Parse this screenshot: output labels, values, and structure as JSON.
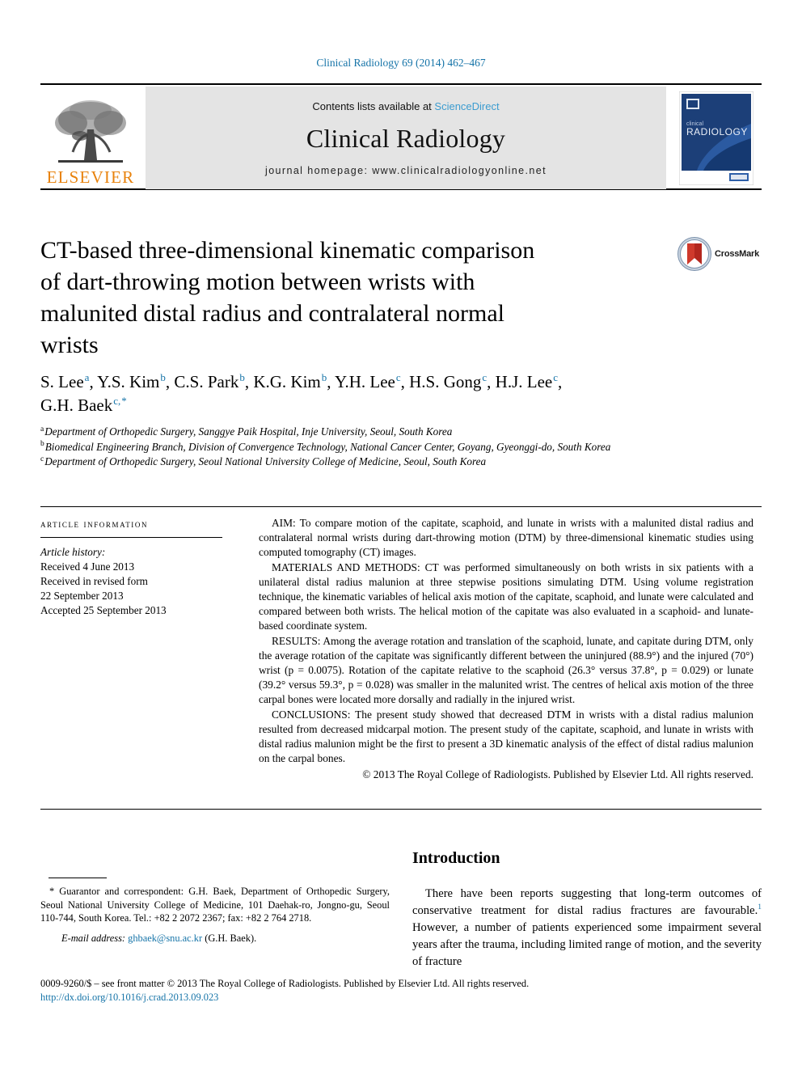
{
  "running_head": "Clinical Radiology 69 (2014) 462–467",
  "masthead": {
    "publisher_name": "ELSEVIER",
    "contents_prefix": "Contents lists available at ",
    "contents_link": "ScienceDirect",
    "journal_title": "Clinical Radiology",
    "homepage": "journal homepage: www.clinicalradiologyonline.net",
    "cover_line1": "clinical",
    "cover_line2": "RADIOLOGY"
  },
  "crossmark": {
    "label": "CrossMark"
  },
  "article": {
    "title": "CT-based three-dimensional kinematic comparison of dart-throwing motion between wrists with malunited distal radius and contralateral normal wrists",
    "authors_line1_parts": [
      {
        "name": "S. Lee",
        "sup": "a",
        "sep": ", "
      },
      {
        "name": "Y.S. Kim",
        "sup": "b",
        "sep": ", "
      },
      {
        "name": "C.S. Park",
        "sup": "b",
        "sep": ", "
      },
      {
        "name": "K.G. Kim",
        "sup": "b",
        "sep": ", "
      },
      {
        "name": "Y.H. Lee",
        "sup": "c",
        "sep": ", "
      },
      {
        "name": "H.S. Gong",
        "sup": "c",
        "sep": ", "
      },
      {
        "name": "H.J. Lee",
        "sup": "c",
        "sep": ","
      }
    ],
    "authors_line2": {
      "name": "G.H. Baek",
      "sup": "c,",
      "star": "*"
    },
    "affiliations": [
      {
        "marker": "a",
        "text": "Department of Orthopedic Surgery, Sanggye Paik Hospital, Inje University, Seoul, South Korea"
      },
      {
        "marker": "b",
        "text": "Biomedical Engineering Branch, Division of Convergence Technology, National Cancer Center, Goyang, Gyeonggi-do, South Korea"
      },
      {
        "marker": "c",
        "text": "Department of Orthopedic Surgery, Seoul National University College of Medicine, Seoul, South Korea"
      }
    ]
  },
  "article_information": {
    "heading": "article information",
    "history_label": "Article history:",
    "history_lines": [
      "Received 4 June 2013",
      "Received in revised form",
      "22 September 2013",
      "Accepted 25 September 2013"
    ]
  },
  "abstract": {
    "aim": "AIM: To compare motion of the capitate, scaphoid, and lunate in wrists with a malunited distal radius and contralateral normal wrists during dart-throwing motion (DTM) by three-dimensional kinematic studies using computed tomography (CT) images.",
    "materials": "MATERIALS AND METHODS: CT was performed simultaneously on both wrists in six patients with a unilateral distal radius malunion at three stepwise positions simulating DTM. Using volume registration technique, the kinematic variables of helical axis motion of the capitate, scaphoid, and lunate were calculated and compared between both wrists. The helical motion of the capitate was also evaluated in a scaphoid- and lunate-based coordinate system.",
    "results": "RESULTS: Among the average rotation and translation of the scaphoid, lunate, and capitate during DTM, only the average rotation of the capitate was significantly different between the uninjured (88.9°) and the injured (70°) wrist (p = 0.0075). Rotation of the capitate relative to the scaphoid (26.3° versus 37.8°, p = 0.029) or lunate (39.2° versus 59.3°, p = 0.028) was smaller in the malunited wrist. The centres of helical axis motion of the three carpal bones were located more dorsally and radially in the injured wrist.",
    "conclusions": "CONCLUSIONS: The present study showed that decreased DTM in wrists with a distal radius malunion resulted from decreased midcarpal motion. The present study of the capitate, scaphoid, and lunate in wrists with distal radius malunion might be the first to present a 3D kinematic analysis of the effect of distal radius malunion on the carpal bones.",
    "copyright": "© 2013 The Royal College of Radiologists. Published by Elsevier Ltd. All rights reserved."
  },
  "introduction": {
    "heading": "Introduction",
    "paragraph_a": "There have been reports suggesting that long-term outcomes of conservative treatment for distal radius fractures are favourable.",
    "ref_marker": "1",
    "paragraph_b": " However, a number of patients experienced some impairment several years after the trauma, including limited range of motion, and the severity of fracture"
  },
  "footnotes": {
    "correspondence": "* Guarantor and correspondent: G.H. Baek, Department of Orthopedic Surgery, Seoul National University College of Medicine, 101 Daehak-ro, Jongno-gu, Seoul 110-744, South Korea. Tel.: +82 2 2072 2367; fax: +82 2 764 2718.",
    "email_label": "E-mail address:",
    "email": "ghbaek@snu.ac.kr",
    "email_suffix": "(G.H. Baek)."
  },
  "bottom": {
    "copyright": "0009-9260/$ – see front matter © 2013 The Royal College of Radiologists. Published by Elsevier Ltd. All rights reserved.",
    "doi": "http://dx.doi.org/10.1016/j.crad.2013.09.023"
  },
  "colors": {
    "link_blue": "#1674a8",
    "sciencedirect_blue": "#3c9cd0",
    "elsevier_orange": "#e8820c",
    "cover_navy": "#1c3f78"
  }
}
